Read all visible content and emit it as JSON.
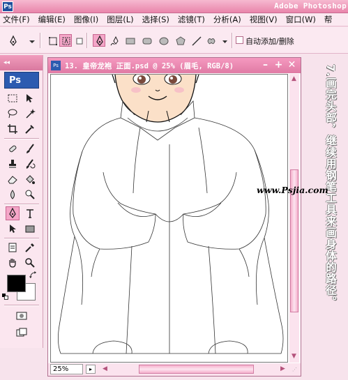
{
  "app": {
    "logo": "Ps",
    "title": "Adobe Photoshop"
  },
  "menu": [
    "文件(F)",
    "编辑(E)",
    "图像(I)",
    "图层(L)",
    "选择(S)",
    "滤镜(T)",
    "分析(A)",
    "视图(V)",
    "窗口(W)",
    "帮"
  ],
  "options": {
    "auto_add_delete_label": "自动添加/删除",
    "auto_add_delete_checked": false
  },
  "toolbox": {
    "logo": "Ps",
    "foreground_color": "#000000",
    "background_color": "#ffffff"
  },
  "document": {
    "title": "13. 皇帝龙袍 正面.psd @ 25% (眉毛, RGB/8)",
    "zoom": "25%",
    "minimize_label": "–",
    "maximize_label": "+",
    "close_label": "✕"
  },
  "side": {
    "instruction": "7.画完头部，继续用钢笔工具来画身体的路径。",
    "watermark": "www.Psjia.com"
  },
  "colors": {
    "accent": "#e985ab",
    "panel": "#fbe9f1",
    "selected": "#f4a6c8"
  }
}
